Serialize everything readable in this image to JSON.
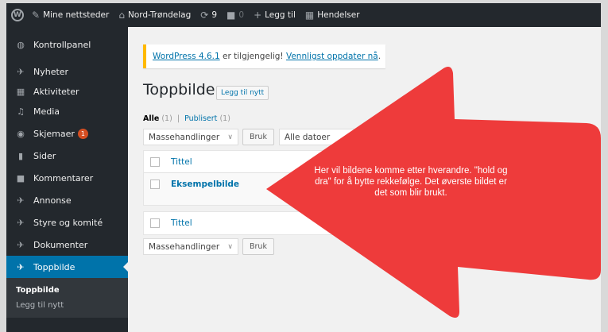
{
  "adminbar": {
    "wp_logo": "W",
    "my_sites": "Mine nettsteder",
    "site_name": "Nord-Trøndelag",
    "updates_count": "9",
    "comments_count": "0",
    "new_label": "Legg til",
    "events_label": "Hendelser"
  },
  "sidebar": {
    "items": [
      {
        "label": "Kontrollpanel",
        "icon": "dashboard-icon"
      },
      {
        "label": "Nyheter",
        "icon": "pin-icon"
      },
      {
        "label": "Aktiviteter",
        "icon": "calendar-icon"
      },
      {
        "label": "Media",
        "icon": "media-icon"
      },
      {
        "label": "Skjemaer",
        "icon": "forms-icon",
        "badge": "1"
      },
      {
        "label": "Sider",
        "icon": "page-icon"
      },
      {
        "label": "Kommentarer",
        "icon": "comment-icon"
      },
      {
        "label": "Annonse",
        "icon": "pin-icon"
      },
      {
        "label": "Styre og komité",
        "icon": "pin-icon"
      },
      {
        "label": "Dokumenter",
        "icon": "pin-icon"
      },
      {
        "label": "Toppbilde",
        "icon": "pin-icon",
        "active": true
      }
    ],
    "submenu": [
      "Toppbilde",
      "Legg til nytt"
    ]
  },
  "notice": {
    "link1": "WordPress 4.6.1",
    "middle": " er tilgjengelig! ",
    "link2": "Vennligst oppdater nå",
    "end": "."
  },
  "page": {
    "title": "Toppbilde",
    "add_new": "Legg til nytt",
    "filter_all": "Alle",
    "filter_all_count": "(1)",
    "separator": "|",
    "filter_published": "Publisert",
    "filter_published_count": "(1)",
    "bulk_actions": "Massehandlinger",
    "apply": "Bruk",
    "all_dates": "Alle datoer",
    "column_title": "Tittel",
    "row_title": "Eksempelbilde"
  },
  "annotation": {
    "text": "Her vil bildene komme etter hverandre. \"hold og dra\" for å bytte rekkefølge. Det øverste bildet er det som blir brukt.",
    "color": "#ee3b3b"
  }
}
